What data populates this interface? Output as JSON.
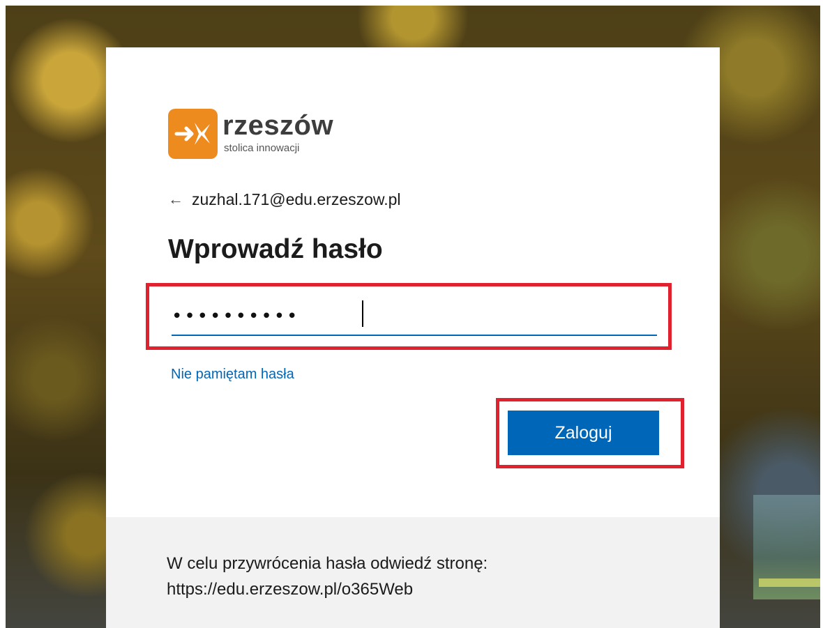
{
  "brand": {
    "name": "rzeszów",
    "tagline": "stolica innowacji",
    "accent_color": "#ee8b1f",
    "icon": "rzeszow-logo-icon"
  },
  "identity": {
    "back_icon": "arrow-left-icon",
    "email": "zuzhal.171@edu.erzeszow.pl"
  },
  "page_title": "Wprowadź hasło",
  "password": {
    "value": "••••••••••",
    "border_color": "#0067b8"
  },
  "forgot_password_link": "Nie pamiętam hasła",
  "signin_button": {
    "label": "Zaloguj",
    "color": "#0067b8"
  },
  "footer": {
    "text": "W celu przywrócenia hasła odwiedź stronę:\nhttps://edu.erzeszow.pl/o365Web"
  },
  "annotation": {
    "highlight_color": "#e0222f"
  }
}
